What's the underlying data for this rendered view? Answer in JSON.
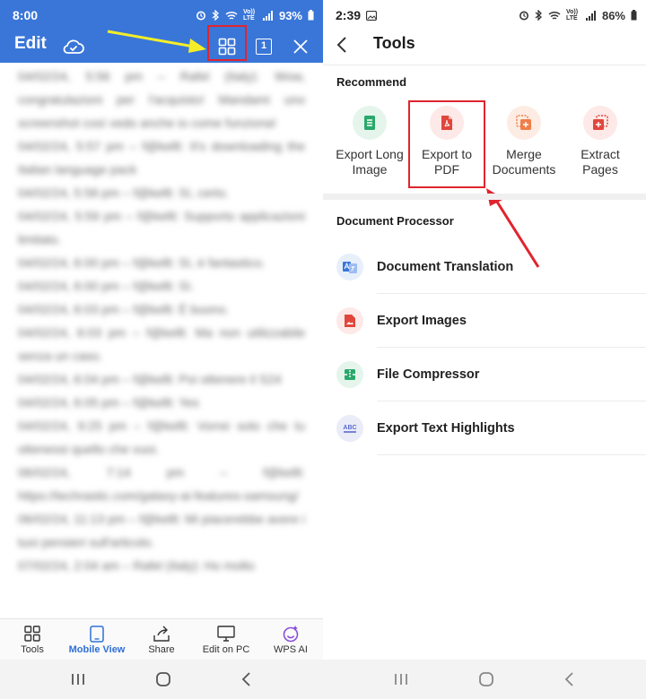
{
  "left": {
    "status": {
      "time": "8:00",
      "signal_label": "Vo)) LTE",
      "battery": "93%"
    },
    "appbar": {
      "title": "Edit",
      "page_badge": "1"
    },
    "content_lines": [
      "04/02/24, 5:56 pm – Rafel (Italy): Wow, congratulazioni per l'acquisto! Mandami uno screenshot così vedo anche io come funziona!",
      "04/02/24, 5:57 pm – f@kellt: It's downloading the Italian language pack",
      "04/02/24, 5:58 pm – f@kellt: Sì, certo.",
      "04/02/24, 5:59 pm – f@kellt: Supporto applicazioni limitato.",
      "04/02/24, 6:00 pm – f@kellt: Sì, è fantastico.",
      "04/02/24, 6:00 pm – f@kellt: Sì.",
      "04/02/24, 6:03 pm – f@kellt: È buono.",
      "04/02/24, 6:03 pm – f@kellt: Ma non utilizzabile senza un caso.",
      "04/02/24, 6:04 pm – f@kellt: Poi ottenere il S24",
      "04/02/24, 6:05 pm – f@kellt: Yes",
      "04/02/24, 9:25 pm – f@kellt: Vorrei solo che tu ottenessi quello che vuoi.",
      "06/02/24, 7:14 pm – f@kellt: https://techrastic.com/galaxy-ai-features-samsung/",
      "06/02/24, 11:13 pm – f@kellt: Mi piacerebbe avere i tuoi pensieri sull'articolo.",
      "07/02/24, 2:04 am – Rafel (Italy): Ho molto"
    ],
    "tabs": [
      {
        "label": "Tools",
        "icon": "grid-icon"
      },
      {
        "label": "Mobile View",
        "icon": "tablet-icon"
      },
      {
        "label": "Share",
        "icon": "share-icon"
      },
      {
        "label": "Edit on PC",
        "icon": "monitor-icon"
      },
      {
        "label": "WPS AI",
        "icon": "sparkle-icon"
      }
    ]
  },
  "right": {
    "status": {
      "time": "2:39",
      "signal_label": "Vo)) LTE",
      "battery": "86%"
    },
    "header": {
      "title": "Tools"
    },
    "recommend": {
      "title": "Recommend",
      "items": [
        {
          "label": "Export Long Image",
          "icon": "long-image-icon",
          "color": "#2aa86b",
          "bg": "#e5f5ec"
        },
        {
          "label": "Export to PDF",
          "icon": "pdf-icon",
          "color": "#e0473c",
          "bg": "#fde9e7"
        },
        {
          "label": "Merge Documents",
          "icon": "merge-icon",
          "color": "#f07e4b",
          "bg": "#fdece3"
        },
        {
          "label": "Extract Pages",
          "icon": "extract-icon",
          "color": "#e0473c",
          "bg": "#fde9e7"
        }
      ]
    },
    "processor": {
      "title": "Document Processor",
      "items": [
        {
          "label": "Document Translation",
          "icon": "translate-icon",
          "color": "#3a76d8",
          "bg": "#e7effb"
        },
        {
          "label": "Export Images",
          "icon": "image-icon",
          "color": "#e0473c",
          "bg": "#fde9e7"
        },
        {
          "label": "File Compressor",
          "icon": "compress-icon",
          "color": "#2aa86b",
          "bg": "#e5f5ec"
        },
        {
          "label": "Export Text Highlights",
          "icon": "abc-highlight-icon",
          "color": "#5b6bd0",
          "bg": "#eaecf8"
        }
      ]
    }
  },
  "colors": {
    "brand_blue": "#3a76d8",
    "highlight_red": "#e0242e",
    "arrow_yellow": "#f4ee29"
  }
}
